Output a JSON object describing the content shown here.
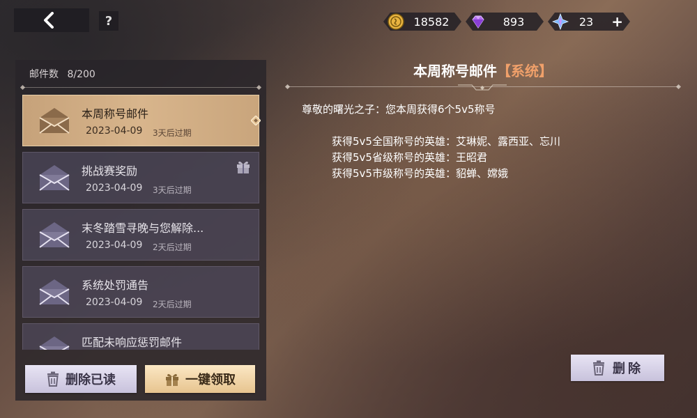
{
  "topbar": {
    "help_label": "?",
    "currencies": [
      {
        "icon": "gold-coin-icon",
        "value": "18582"
      },
      {
        "icon": "purple-diamond-icon",
        "value": "893"
      },
      {
        "icon": "blue-star-crystal-icon",
        "value": "23",
        "plus": "+"
      }
    ]
  },
  "sidebar": {
    "mail_count_label": "邮件数",
    "mail_count_value": "8/200",
    "mails": [
      {
        "title": "本周称号邮件",
        "date": "2023-04-09",
        "expire": "3天后过期",
        "selected": true,
        "has_gift": false
      },
      {
        "title": "挑战赛奖励",
        "date": "2023-04-09",
        "expire": "3天后过期",
        "selected": false,
        "has_gift": true
      },
      {
        "title": "末冬踏雪寻晚与您解除...",
        "date": "2023-04-09",
        "expire": "2天后过期",
        "selected": false,
        "has_gift": false
      },
      {
        "title": "系统处罚通告",
        "date": "2023-04-09",
        "expire": "2天后过期",
        "selected": false,
        "has_gift": false
      },
      {
        "title": "匹配未响应惩罚邮件",
        "date": "",
        "expire": "",
        "selected": false,
        "has_gift": false
      }
    ],
    "delete_read_label": "删除已读",
    "claim_all_label": "一键领取"
  },
  "mail_detail": {
    "title": "本周称号邮件",
    "tag": "【系统】",
    "greeting": "尊敬的曙光之子：您本周获得6个5v5称号",
    "lines": [
      "获得5v5全国称号的英雄：艾琳妮、露西亚、忘川",
      "获得5v5省级称号的英雄：王昭君",
      "获得5v5市级称号的英雄：貂蝉、嫦娥"
    ],
    "delete_label": "删除"
  },
  "colors": {
    "selected_mail": "#d8b58c",
    "tag": "#f0a06a",
    "claim_button": "#e7c48f",
    "delete_button": "#c8c2dc"
  }
}
